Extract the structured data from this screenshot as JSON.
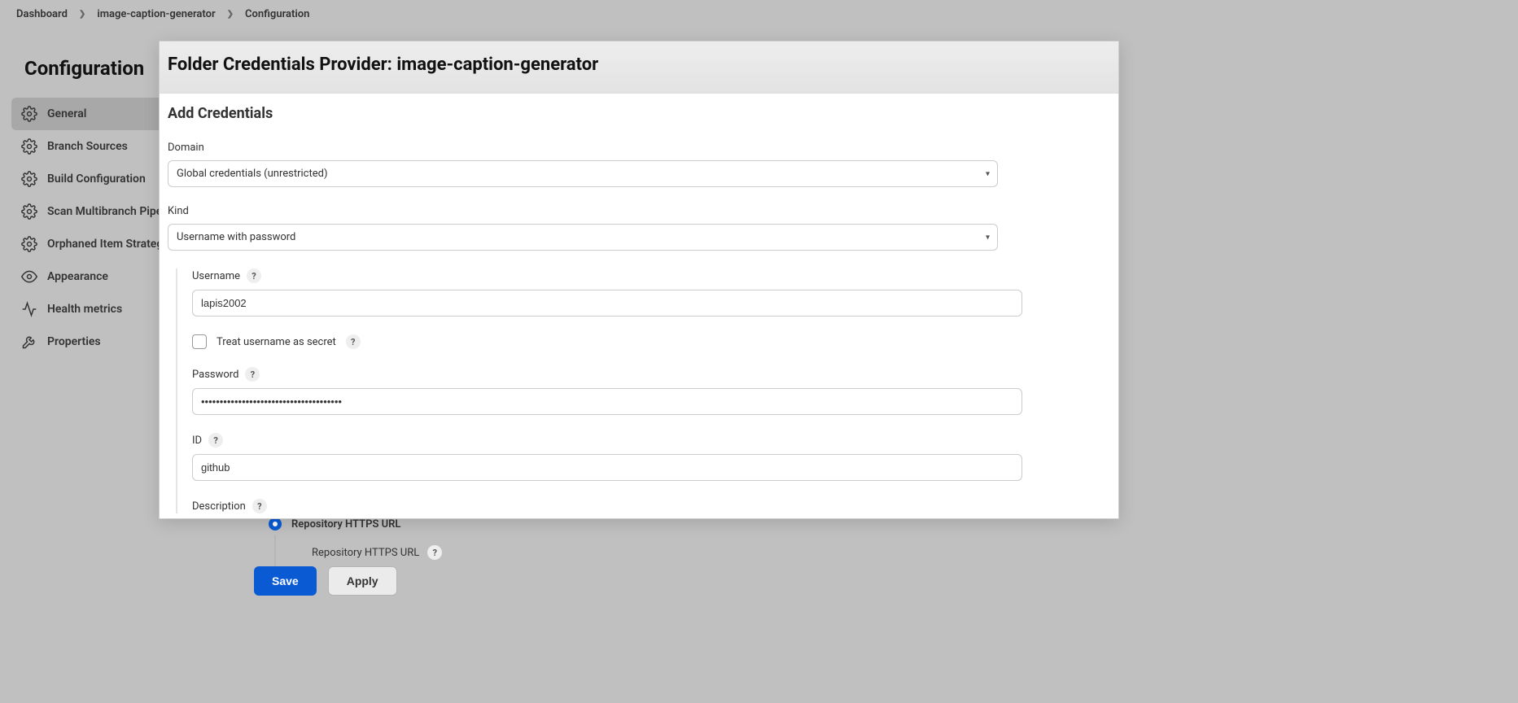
{
  "breadcrumb": {
    "items": [
      "Dashboard",
      "image-caption-generator",
      "Configuration"
    ]
  },
  "page_title": "Configuration",
  "sidebar": {
    "items": [
      {
        "label": "General"
      },
      {
        "label": "Branch Sources"
      },
      {
        "label": "Build Configuration"
      },
      {
        "label": "Scan Multibranch Pipeline Triggers"
      },
      {
        "label": "Orphaned Item Strategy"
      },
      {
        "label": "Appearance"
      },
      {
        "label": "Health metrics"
      },
      {
        "label": "Properties"
      }
    ]
  },
  "behind": {
    "radio_label": "Repository HTTPS URL",
    "sub_label": "Repository HTTPS URL"
  },
  "actions": {
    "save": "Save",
    "apply": "Apply"
  },
  "modal": {
    "title": "Folder Credentials Provider: image-caption-generator",
    "subtitle": "Add Credentials",
    "domain_label": "Domain",
    "domain_value": "Global credentials (unrestricted)",
    "kind_label": "Kind",
    "kind_value": "Username with password",
    "username_label": "Username",
    "username_value": "lapis2002",
    "treat_label": "Treat username as secret",
    "password_label": "Password",
    "password_value": "••••••••••••••••••••••••••••••••••••••",
    "id_label": "ID",
    "id_value": "github",
    "description_label": "Description"
  },
  "icons": {
    "help": "?"
  }
}
